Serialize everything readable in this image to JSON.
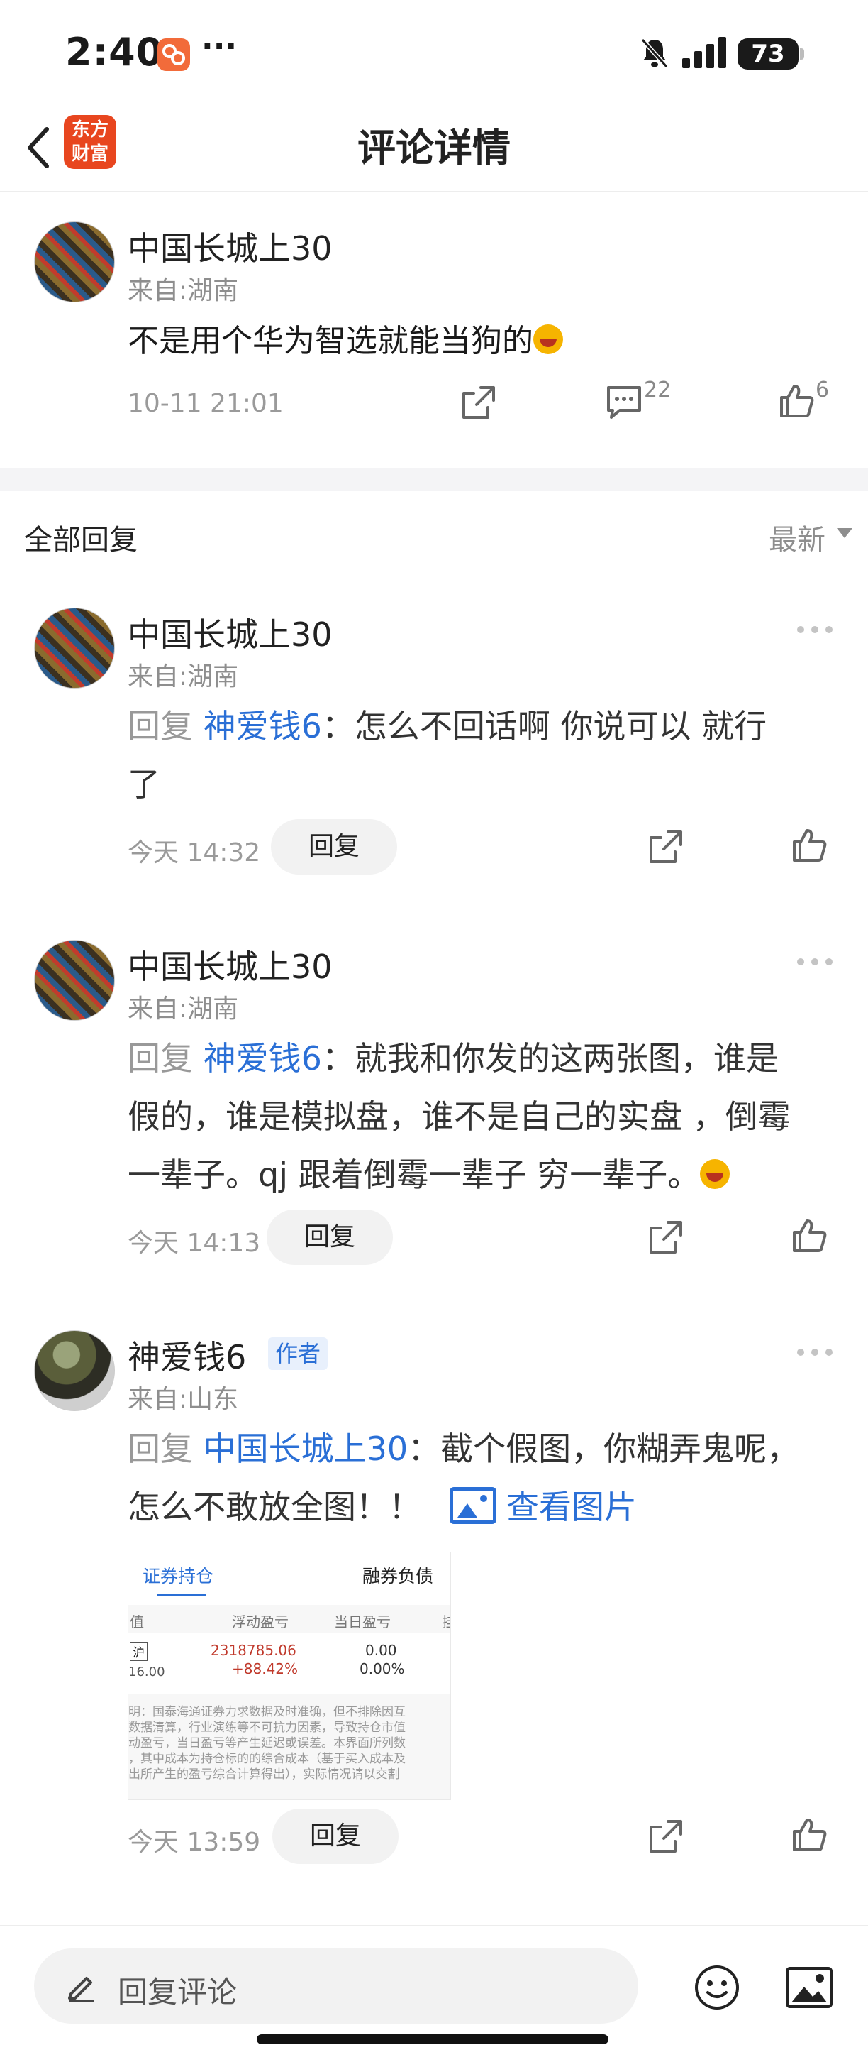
{
  "status_bar": {
    "time": "2:40",
    "battery": "73"
  },
  "nav": {
    "title": "评论详情",
    "logo_line1": "东方",
    "logo_line2": "财富"
  },
  "main_comment": {
    "username": "中国长城上30",
    "location": "来自:湖南",
    "text": "不是用个华为智选就能当狗的",
    "time": "10-11 21:01",
    "comment_count": "22",
    "like_count": "6"
  },
  "section": {
    "title": "全部回复",
    "sort_label": "最新"
  },
  "replies": [
    {
      "username": "中国长城上30",
      "location": "来自:湖南",
      "prefix": "回复 ",
      "mention": "神爱钱6",
      "line1": "：怎么不回话啊 你说可以 就行",
      "line2": "了",
      "time": "今天 14:32",
      "reply_label": "回复"
    },
    {
      "username": "中国长城上30",
      "location": "来自:湖南",
      "prefix": "回复 ",
      "mention": "神爱钱6",
      "line1": "：就我和你发的这两张图，谁是",
      "line2": "假的，谁是模拟盘，谁不是自己的实盘 ，倒霉",
      "line3": "一辈子。qj 跟着倒霉一辈子 穷一辈子。",
      "time": "今天 14:13",
      "reply_label": "回复"
    },
    {
      "username": "神爱钱6",
      "author_tag": "作者",
      "location": "来自:山东",
      "prefix": "回复 ",
      "mention": "中国长城上30",
      "line1": "：截个假图，你糊弄鬼呢，",
      "line2": "怎么不敢放全图！！",
      "view_picture": "查看图片",
      "time": "今天 13:59",
      "reply_label": "回复",
      "thumbnail": {
        "tab_active": "证券持仓",
        "tab_other": "融券负债",
        "col_value": "值",
        "col_float": "浮动盈亏",
        "col_today": "当日盈亏",
        "col_more": "挂",
        "market": "沪",
        "value_small": "16.00",
        "float_amount": "2318785.06",
        "float_pct": "+88.42%",
        "today_amount": "0.00",
        "today_pct": "0.00%",
        "note_lines": [
          "明：国泰海通证券力求数据及时准确，但不排除因互",
          "数据清算，行业演练等不可抗力因素，导致持仓市值",
          "动盈亏，当日盈亏等产生延迟或误差。本界面所列数",
          "，其中成本为持仓标的的综合成本（基于买入成本及",
          "出所产生的盈亏综合计算得出），实际情况请以交割"
        ]
      }
    }
  ],
  "bottom_bar": {
    "placeholder": "回复评论"
  },
  "colors": {
    "link": "#2a6fd6",
    "logo": "#e8461f",
    "muted": "#8e8e8e"
  }
}
